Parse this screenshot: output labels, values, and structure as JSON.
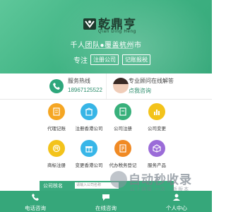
{
  "brand": {
    "name": "乾鼎亨",
    "pinyin": "Qian Ding Heng",
    "slogan": "千人团队●覆盖杭州市",
    "lead": "专注",
    "tags": [
      "注册公司",
      "记账报税"
    ]
  },
  "info": {
    "hotline_label": "服务热线",
    "hotline_number": "18967125522",
    "advisor_label": "专业顾问在线解答",
    "advisor_action": "点我咨询"
  },
  "services": [
    {
      "label": "代理记账",
      "color": "#f5a623",
      "icon": "ledger-icon"
    },
    {
      "label": "注册香港公司",
      "color": "#37b5e6",
      "icon": "building-icon"
    },
    {
      "label": "公司注册",
      "color": "#38b07b",
      "icon": "document-icon"
    },
    {
      "label": "公司变更",
      "color": "#f3c31b",
      "icon": "chart-icon"
    },
    {
      "label": "商标注册",
      "color": "#f3c31b",
      "icon": "trademark-icon"
    },
    {
      "label": "变更香港公司",
      "color": "#38b6e8",
      "icon": "gift-icon"
    },
    {
      "label": "代办税务登记",
      "color": "#f08a24",
      "icon": "tax-icon"
    },
    {
      "label": "服务产品",
      "color": "#9b6cd8",
      "icon": "box-icon"
    }
  ],
  "search": {
    "label": "公司核名",
    "placeholder": "请输入公司名称"
  },
  "watermark": {
    "title": "自动秒收录",
    "subtitle": "以上链接 一次 · 新版本"
  },
  "nav": [
    {
      "label": "电话咨询",
      "icon": "phone-icon"
    },
    {
      "label": "在线咨询",
      "icon": "chat-icon"
    },
    {
      "label": "个人中心",
      "icon": "user-icon"
    }
  ],
  "colors": {
    "primary": "#36a77a",
    "hero": "#4bbd8c"
  }
}
